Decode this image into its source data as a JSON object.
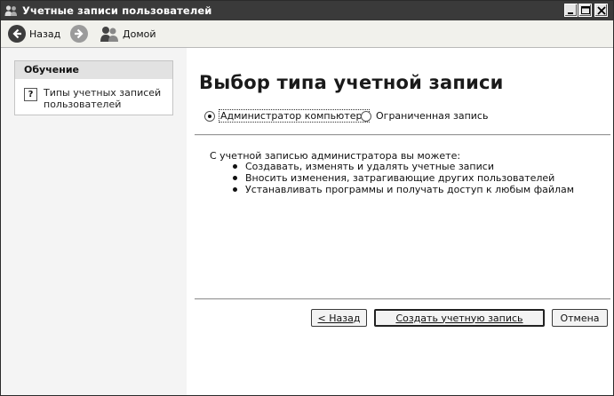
{
  "window": {
    "title": "Учетные записи пользователей"
  },
  "toolbar": {
    "back_label": "Назад",
    "home_label": "Домой"
  },
  "learn": {
    "header": "Обучение",
    "items": [
      {
        "label": "Типы учетных записей пользователей"
      }
    ]
  },
  "main": {
    "title": "Выбор типа учетной записи",
    "options": [
      {
        "label": "Администратор компьютера",
        "selected": true
      },
      {
        "label": "Ограниченная запись",
        "selected": false
      }
    ],
    "description": "С учетной записью администратора вы можете:",
    "bullets": [
      "Создавать, изменять и удалять учетные записи",
      "Вносить изменения, затрагивающие других пользователей",
      "Устанавливать программы и получать доступ к любым файлам"
    ]
  },
  "buttons": {
    "back": "< Назад",
    "create": "Создать учетную запись",
    "cancel": "Отмена"
  },
  "colors": {
    "titlebar": "#3a3a3a",
    "panel": "#f4f4f4"
  }
}
